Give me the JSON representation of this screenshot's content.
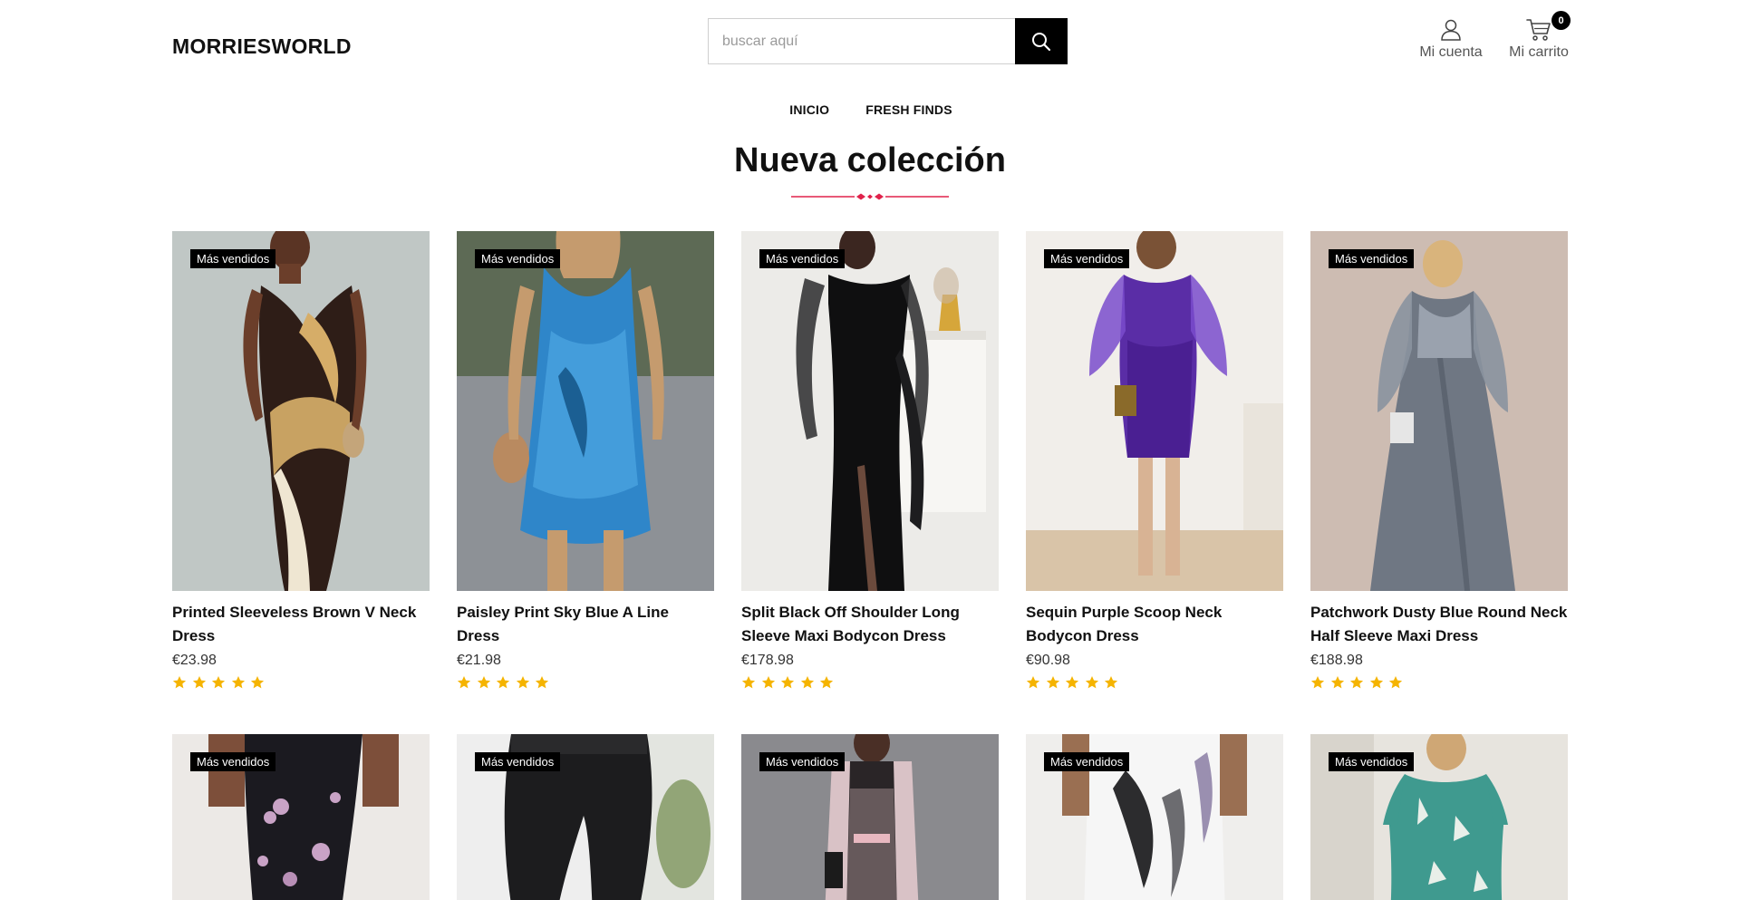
{
  "header": {
    "logo": "MORRIESWORLD",
    "search_placeholder": "buscar aquí",
    "account_label": "Mi cuenta",
    "cart_label": "Mi carrito",
    "cart_count": "0"
  },
  "nav": [
    {
      "label": "INICIO"
    },
    {
      "label": "FRESH FINDS"
    }
  ],
  "section": {
    "title": "Nueva colección"
  },
  "colors": {
    "accent": "#e0224b",
    "star": "#f5b400",
    "badge_bg": "#000000"
  },
  "products": [
    {
      "name": "Printed Sleeveless Brown V Neck Dress",
      "price": "€23.98",
      "badge": "Más vendidos",
      "rating": 5
    },
    {
      "name": "Paisley Print Sky Blue A Line Dress",
      "price": "€21.98",
      "badge": "Más vendidos",
      "rating": 5
    },
    {
      "name": "Split Black Off Shoulder Long Sleeve Maxi Bodycon Dress",
      "price": "€178.98",
      "badge": "Más vendidos",
      "rating": 5
    },
    {
      "name": "Sequin Purple Scoop Neck Bodycon Dress",
      "price": "€90.98",
      "badge": "Más vendidos",
      "rating": 5
    },
    {
      "name": "Patchwork Dusty Blue Round Neck Half Sleeve Maxi Dress",
      "price": "€188.98",
      "badge": "Más vendidos",
      "rating": 5
    },
    {
      "badge": "Más vendidos"
    },
    {
      "badge": "Más vendidos"
    },
    {
      "badge": "Más vendidos"
    },
    {
      "badge": "Más vendidos"
    },
    {
      "badge": "Más vendidos"
    }
  ]
}
